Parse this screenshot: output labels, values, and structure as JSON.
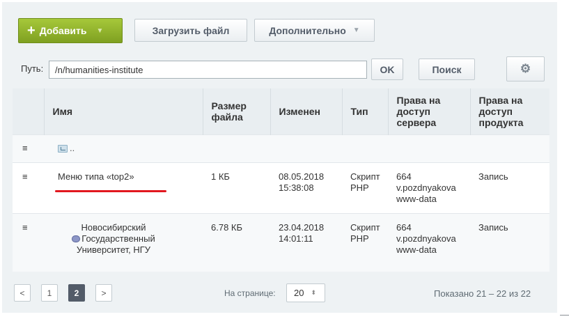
{
  "toolbar": {
    "add_label": "Добавить",
    "upload_label": "Загрузить файл",
    "more_label": "Дополнительно"
  },
  "path": {
    "label": "Путь:",
    "value": "/n/humanities-institute",
    "ok_label": "OK",
    "search_label": "Поиск"
  },
  "table": {
    "headers": {
      "name": "Имя",
      "size": "Размер файла",
      "modified": "Изменен",
      "type": "Тип",
      "server_rights": "Права на доступ сервера",
      "product_rights": "Права на доступ продукта"
    },
    "parent_label": "..",
    "rows": [
      {
        "name": "Меню типа «top2»",
        "size": "1 КБ",
        "modified": "08.05.2018 15:38:08",
        "type": "Скрипт PHP",
        "server_rights": [
          "664",
          "v.pozdnyakova",
          "www-data"
        ],
        "product_rights": "Запись"
      },
      {
        "name_lines": [
          "Новосибирский",
          "Государственный",
          "Университет, НГУ"
        ],
        "size": "6.78 КБ",
        "modified": "23.04.2018 14:01:11",
        "type": "Скрипт PHP",
        "server_rights": [
          "664",
          "v.pozdnyakova",
          "www-data"
        ],
        "product_rights": "Запись"
      }
    ]
  },
  "pagination": {
    "prev": "<",
    "pages": [
      "1",
      "2"
    ],
    "current": "2",
    "next": ">",
    "per_page_label": "На странице:",
    "per_page_value": "20",
    "shown": "Показано 21 – 22 из 22"
  },
  "colors": {
    "add_button": "#8cb12c",
    "underline": "#e2181f",
    "active_page": "#535c69"
  }
}
